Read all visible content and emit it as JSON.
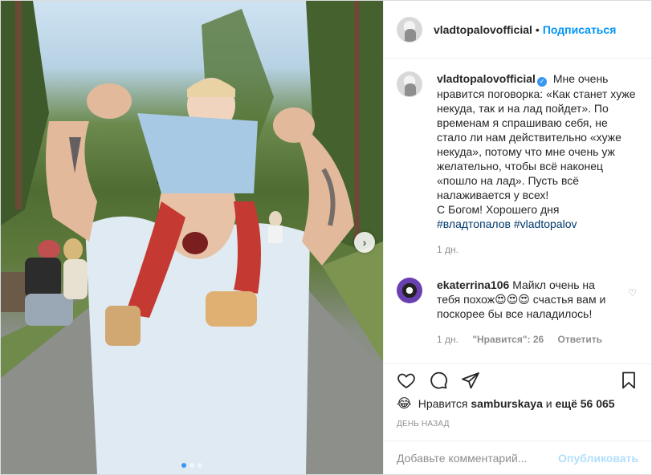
{
  "header": {
    "username": "vladtopalovofficial",
    "separator": "•",
    "follow_label": "Подписаться"
  },
  "caption": {
    "username": "vladtopalovofficial",
    "verified_icon": "✓",
    "text_lines": [
      "Мне очень нравится поговорка: «Как станет хуже некуда, так и на лад пойдет». По временам я спрашиваю себя, не стало ли нам действительно «хуже некуда», потому что мне очень уж желательно, чтобы всё наконец «пошло на лад». Пусть всё налаживается у всех!",
      "С Богом! Хорошего дня"
    ],
    "hashtag_1": "#владтопалов",
    "hashtag_2": "#vladtopalov",
    "age": "1 дн."
  },
  "comment": {
    "username": "ekaterrina106",
    "text": "Майкл очень на тебя похож😍😍😍 счастья вам и поскорее бы все наладилось!",
    "age": "1 дн.",
    "likes_label": "\"Нравится\": 26",
    "reply_label": "Ответить"
  },
  "likes": {
    "emoji": "😂",
    "prefix": "Нравится",
    "user": "samburskaya",
    "middle": "и",
    "rest": "ещё 56 065"
  },
  "timestamp": "ДЕНЬ НАЗАД",
  "add_comment": {
    "placeholder": "Добавьте комментарий...",
    "publish_label": "Опубликовать"
  },
  "icons": [
    "heart-icon",
    "comment-icon",
    "share-icon",
    "bookmark-icon",
    "chevron-right-icon"
  ],
  "colors": {
    "link": "#0095f6",
    "hashtag": "#00376b",
    "muted": "#8e8e8e",
    "carousel_active": "#3897f0"
  },
  "carousel": {
    "slides": 3,
    "active_index": 0
  }
}
